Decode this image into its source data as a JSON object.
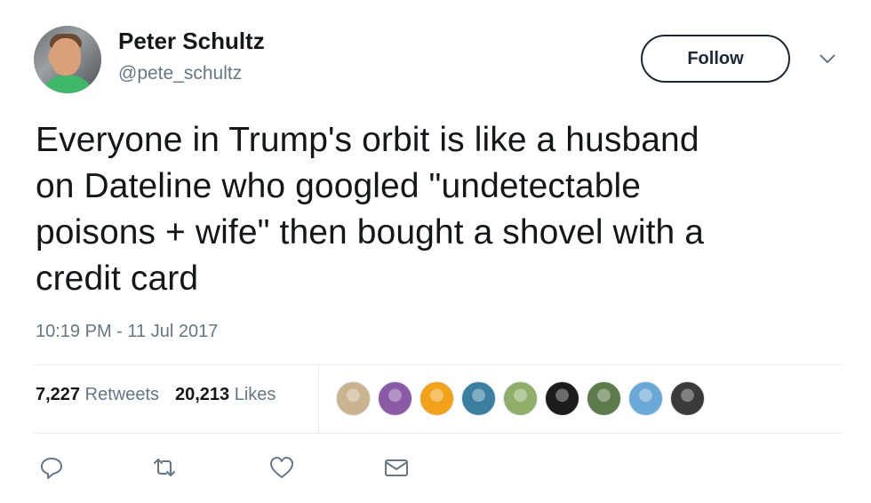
{
  "author": {
    "name": "Peter Schultz",
    "handle": "@pete_schultz",
    "avatar_icon": "profile-photo"
  },
  "follow_label": "Follow",
  "menu_icon": "chevron-down-icon",
  "tweet": {
    "lines": [
      "Everyone in Trump's orbit is like a husband",
      "on Dateline who googled \"undetectable",
      "poisons + wife\" then bought a shovel with a",
      "credit card"
    ],
    "timestamp": "10:19 PM - 11 Jul 2017"
  },
  "stats": {
    "retweets_count": "7,227",
    "retweets_label": "Retweets",
    "likes_count": "20,213",
    "likes_label": "Likes"
  },
  "likers_colors": [
    "#c9b48f",
    "#8a5aa6",
    "#f2a21a",
    "#3b7fa0",
    "#8fae6a",
    "#1c1c1c",
    "#5c7a4a",
    "#6aa9d6",
    "#3a3a3a"
  ],
  "actions": [
    "reply-icon",
    "retweet-icon",
    "like-icon",
    "direct-message-icon"
  ],
  "colors": {
    "text": "#14171a",
    "secondary": "#657786",
    "border": "#e6ecf0"
  }
}
